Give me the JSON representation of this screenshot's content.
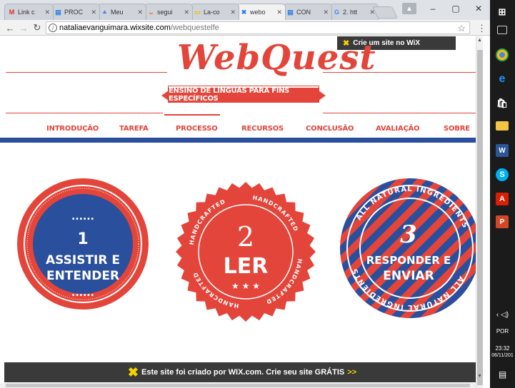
{
  "browser": {
    "tabs": [
      {
        "title": "Link c",
        "icon": "gmail-icon",
        "color": "#d93025"
      },
      {
        "title": "PROC",
        "icon": "wix-page-icon",
        "color": "#2a7de1"
      },
      {
        "title": "Meu",
        "icon": "drive-icon",
        "color": "#4285f4"
      },
      {
        "title": "segui",
        "icon": "orange-u-icon",
        "color": "#ff6600"
      },
      {
        "title": "La-co",
        "icon": "folder-icon",
        "color": "#f4b400"
      },
      {
        "title": "webo",
        "icon": "wix-x-icon",
        "color": "#2a7de1",
        "active": true
      },
      {
        "title": "CON",
        "icon": "wix-page-icon",
        "color": "#2a7de1"
      },
      {
        "title": "2. htt",
        "icon": "google-icon",
        "color": "#4285f4"
      }
    ],
    "url": {
      "host": "nataliaevanguimara.wixsite.com",
      "path": "/webquestelfe"
    },
    "window_controls": {
      "minimize": "–",
      "maximize": "▢",
      "close": "✕"
    }
  },
  "page": {
    "wix_top_banner": "Crie um site no WiX",
    "logo": "WebQuest",
    "ribbon": "ENSINO DE LÍNGUAS PARA FINS ESPECÍFICOS",
    "nav": [
      "INTRODUÇÃO",
      "TAREFA",
      "PROCESSO",
      "RECURSOS",
      "CONCLUSÃO",
      "AVALIAÇÃO",
      "SOBRE"
    ],
    "active_nav": "PROCESSO",
    "badges": [
      {
        "dots": "......",
        "number": "1",
        "line1": "ASSISTIR E",
        "line2": "ENTENDER"
      },
      {
        "ring_text": "HANDCRAFTED",
        "number": "2",
        "line1": "LER",
        "stars": "★ ★ ★"
      },
      {
        "ring_text": "ALL NATURAL INGREDIENTS",
        "number": "3",
        "line1": "RESPONDER E",
        "line2": "ENVIAR"
      }
    ],
    "wix_bottom_banner": {
      "text": "Este site foi criado por WIX.com. Crie seu site GRÁTIS",
      "arrow": ">>"
    },
    "colors": {
      "red": "#e3453a",
      "blue": "#2a4f9c",
      "dark": "#3a3a3a",
      "yellow": "#f5d200"
    }
  },
  "taskbar": {
    "language": "POR",
    "time": "23:32",
    "date": "06/11/201"
  }
}
